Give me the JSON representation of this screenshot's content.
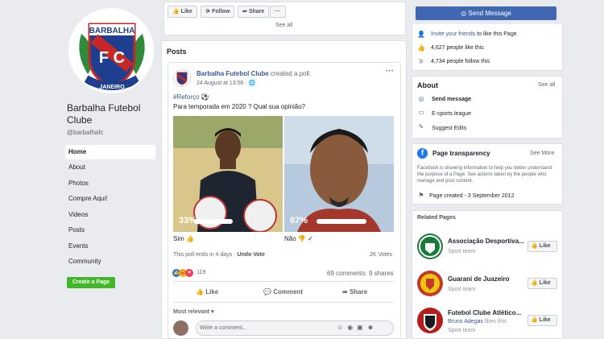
{
  "profile": {
    "name": "Barbalha Futebol Clube",
    "handle": "@barbalhafc",
    "logo_top_text": "BARBALHA",
    "logo_letters": "F C",
    "logo_bottom_text": "JANEIRO"
  },
  "left_nav": {
    "items": [
      {
        "label": "Home"
      },
      {
        "label": "About"
      },
      {
        "label": "Photos"
      },
      {
        "label": "Compre Aqui!"
      },
      {
        "label": "Videos"
      },
      {
        "label": "Posts"
      },
      {
        "label": "Events"
      },
      {
        "label": "Community"
      }
    ],
    "create_page": "Create a Page"
  },
  "actions": {
    "like": "Like",
    "follow": "Follow",
    "share": "Share",
    "more": "···",
    "send_message": "Send Message"
  },
  "posts_section": {
    "see_all": "See all",
    "title": "Posts"
  },
  "post": {
    "author": "Barbalha Futebol Clube",
    "verb": "created a poll.",
    "date": "24 August at 13:56 · ",
    "hashtag": "#Reforço ⚽",
    "text": "Para temporada em 2020 ? Qual sua opinião?",
    "more": "···",
    "poll": {
      "options": [
        {
          "percent": "33%",
          "fill": 0.33,
          "label": "Sim 👍"
        },
        {
          "percent": "67%",
          "fill": 0.67,
          "label": "Não 👎 ✓"
        }
      ],
      "ends": "This poll ends in 4 days ·",
      "undo": "Undo Vote",
      "votes": "2K Votes"
    },
    "reactions_count": "119",
    "comments_count": "69 comments",
    "shares_count": "9 shares",
    "like_label": "Like",
    "comment_label": "Comment",
    "share_label": "Share",
    "sort": "Most relevant ▾",
    "comment_placeholder": "Write a comment..."
  },
  "community": {
    "invite_link": "Invite your friends",
    "invite_rest": " to like this Page",
    "likes": "4,627 people like this",
    "follows": "4,734 people follow this"
  },
  "about": {
    "title": "About",
    "see_all": "See all",
    "send_message": "Send message",
    "category": "E-sports league",
    "suggest": "Suggest Edits"
  },
  "transparency": {
    "title": "Page transparency",
    "see_more": "See More",
    "body": "Facebook is showing information to help you better understand the purpose of a Page. See actions taken by the people who manage and post content.",
    "created": "Page created - 3 September 2012"
  },
  "related": {
    "title": "Related Pages",
    "like_label": "Like",
    "pages": [
      {
        "name": "Associação Desportiva...",
        "sub": "Sport team",
        "color": "#1a7a3c"
      },
      {
        "name": "Guarani de Juazeiro",
        "sub": "Sport team",
        "color": "#c0392b"
      },
      {
        "name": "Futebol Clube Atlético...",
        "liker": "Bruno Adegas",
        "liker_rest": " likes this",
        "sub": "Sport team",
        "color": "#b71c1c"
      }
    ]
  }
}
